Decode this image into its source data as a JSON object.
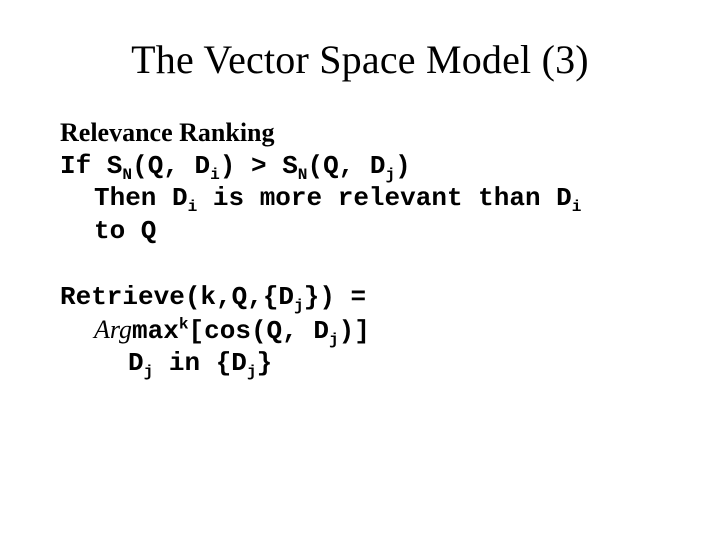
{
  "title": "The Vector Space Model (3)",
  "sections": {
    "relevance": {
      "heading": "Relevance Ranking",
      "line1": {
        "if": "If S",
        "n1": "N",
        "args1": "(Q, D",
        "i1": "i",
        "gt": ") > S",
        "n2": "N",
        "args2": "(Q, D",
        "j": "j",
        "close": ")"
      },
      "line2": {
        "then": "Then D",
        "i1": "i",
        "mid": " is more relevant than D",
        "i2": "i"
      },
      "line3": "to Q"
    },
    "retrieve": {
      "line1": {
        "head": "Retrieve(k,Q,{D",
        "j": "j",
        "tail": "}) ="
      },
      "line2": {
        "arg": "Arg",
        "max": "max",
        "k": "k",
        "cos": "[cos(Q, D",
        "j": "j",
        "close": ")]"
      },
      "line3": {
        "d": "D",
        "j1": "j",
        "in": " in {D",
        "j2": "j",
        "close": "}"
      }
    }
  }
}
